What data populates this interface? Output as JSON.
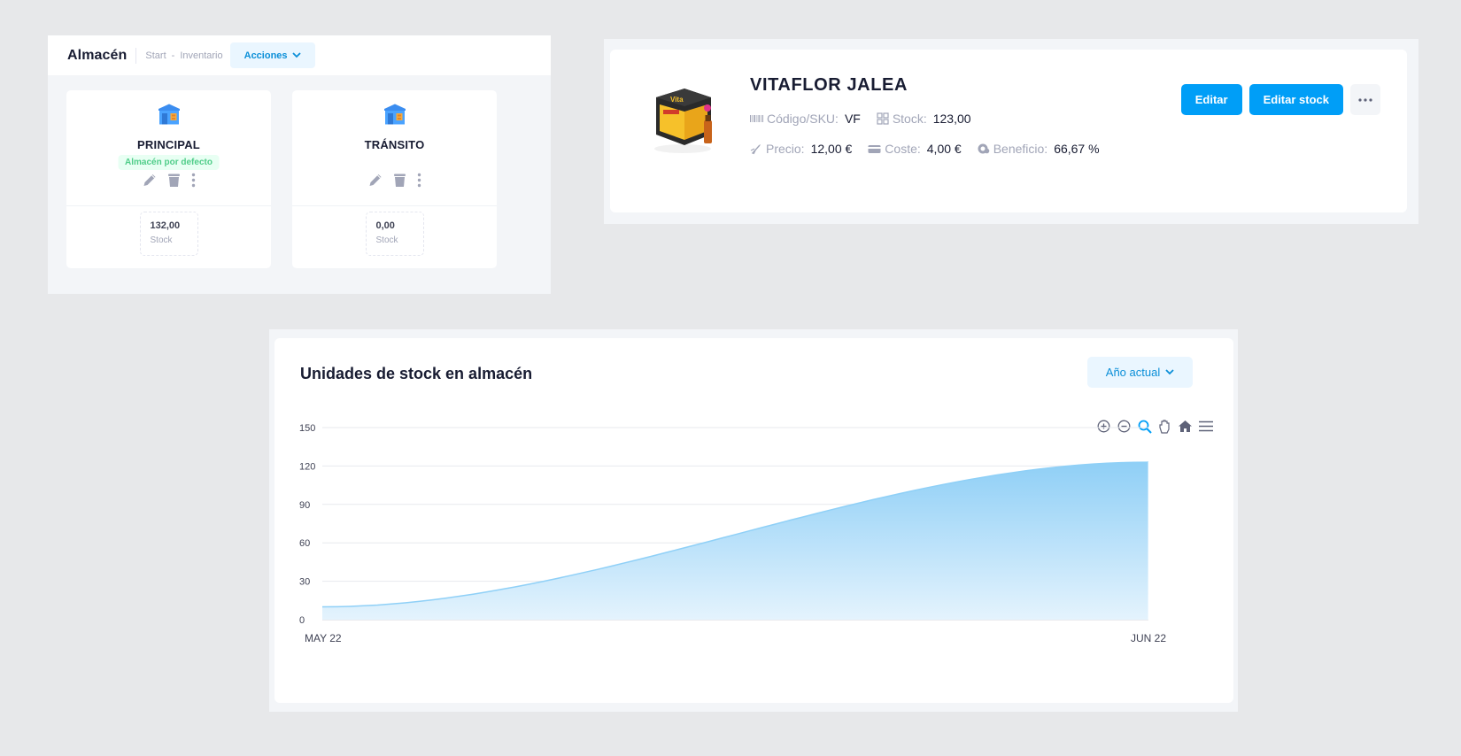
{
  "warehouse_panel": {
    "title": "Almacén",
    "breadcrumb": [
      "Start",
      "-",
      "Inventario"
    ],
    "actions_label": "Acciones",
    "cards": [
      {
        "name": "PRINCIPAL",
        "badge": "Almacén por defecto",
        "stock_value": "132,00",
        "stock_label": "Stock"
      },
      {
        "name": "TRÁNSITO",
        "badge": "",
        "stock_value": "0,00",
        "stock_label": "Stock"
      }
    ],
    "icons": [
      "warehouse-icon",
      "pencil-icon",
      "trash-icon",
      "kebab-icon"
    ]
  },
  "product": {
    "name": "VITAFLOR JALEA",
    "sku_label": "Código/SKU:",
    "sku_value": "VF",
    "stock_label": "Stock:",
    "stock_value": "123,00",
    "price_label": "Precio:",
    "price_value": "12,00 €",
    "cost_label": "Coste:",
    "cost_value": "4,00 €",
    "profit_label": "Beneficio:",
    "profit_value": "66,67 %",
    "edit_label": "Editar",
    "edit_stock_label": "Editar stock",
    "more_label": "···",
    "colors": {
      "primary": "#009ef7",
      "light": "#eaf6ff"
    }
  },
  "stock_chart": {
    "title": "Unidades de stock en almacén",
    "period_select": "Año actual",
    "toolbar": [
      "zoom-in-icon",
      "zoom-out-icon",
      "magnifier-icon",
      "pan-hand-icon",
      "home-icon",
      "menu-icon"
    ]
  },
  "chart_data": {
    "type": "area",
    "title": "Unidades de stock en almacén",
    "x": [
      "MAY 22",
      "JUN 22"
    ],
    "series": [
      {
        "values": [
          10,
          123
        ],
        "color": "#8fd0f7"
      }
    ],
    "y_ticks": [
      0,
      30,
      60,
      90,
      120,
      150
    ],
    "ylim": [
      0,
      150
    ],
    "xlabel": "",
    "ylabel": "",
    "grid": true,
    "curve": "smooth"
  }
}
